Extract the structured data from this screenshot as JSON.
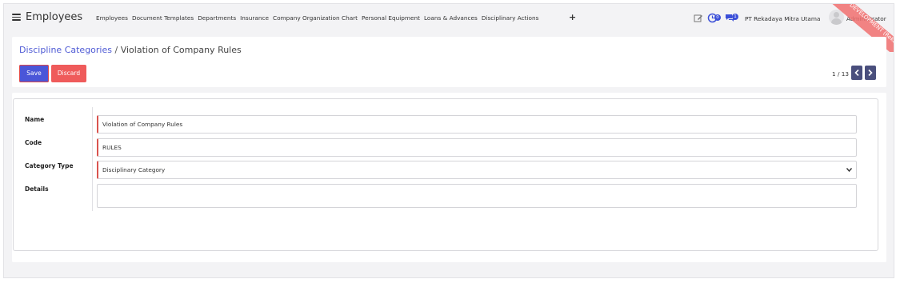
{
  "navbar": {
    "app_title": "Employees",
    "menu": [
      "Employees",
      "Document Templates",
      "Departments",
      "Insurance",
      "Company Organization Chart",
      "Personal Equipment",
      "Loans & Advances",
      "Disciplinary Actions"
    ],
    "activity_badge": "0",
    "message_badge": "1",
    "company": "PT Rekadaya Mitra Utama",
    "user": "Administrator",
    "ribbon_text": "TRAINING DEVELOPMENT (Rekadaya)"
  },
  "control_panel": {
    "breadcrumb_parent": "Discipline Categories",
    "breadcrumb_separator": "/",
    "breadcrumb_current": "Violation of Company Rules",
    "save_label": "Save",
    "discard_label": "Discard",
    "pager": "1 / 13"
  },
  "form": {
    "name_label": "Name",
    "name_value": "Violation of Company Rules",
    "code_label": "Code",
    "code_value": "RULES",
    "category_type_label": "Category Type",
    "category_type_value": "Disciplinary Category",
    "details_label": "Details",
    "details_value": ""
  },
  "colors": {
    "primary": "#4a56d8",
    "discard": "#ef5b5b",
    "link": "#4f5bd5",
    "required_border": "#d9534f",
    "pager_button": "#4a4f7d"
  },
  "icons": [
    "apps-menu-icon",
    "plus-icon",
    "edit-icon",
    "clock-icon",
    "chat-icon",
    "avatar",
    "chevron-left-icon",
    "chevron-right-icon",
    "chevron-down-icon"
  ]
}
